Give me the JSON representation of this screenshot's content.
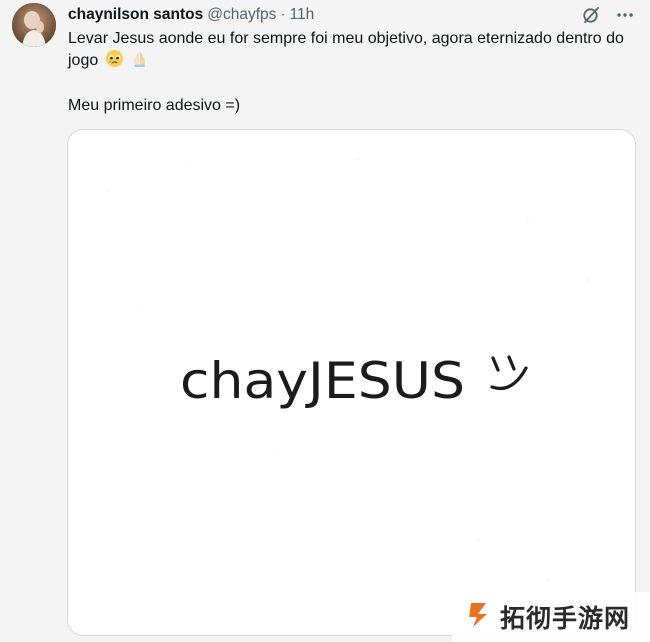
{
  "tweet": {
    "author_name": "chaynilson santos",
    "handle": "@chayfps",
    "separator": "·",
    "time": "11h",
    "text_line1": "Levar Jesus aonde eu for sempre foi meu objetivo, agora eternizado dentro do jogo",
    "text_line2": "Meu primeiro adesivo =)",
    "emojis": [
      "pleading-face-emoji",
      "folded-hands-emoji"
    ],
    "media": {
      "image_text": "chayJESUS",
      "smiley": "smiley-icon"
    }
  },
  "watermark": {
    "text": "拓彻手游网",
    "logo": "watermark-logo-icon"
  },
  "colors": {
    "background": "#f4f4f4",
    "text": "#0f1419",
    "muted": "#536471",
    "border": "#cfd9de"
  }
}
